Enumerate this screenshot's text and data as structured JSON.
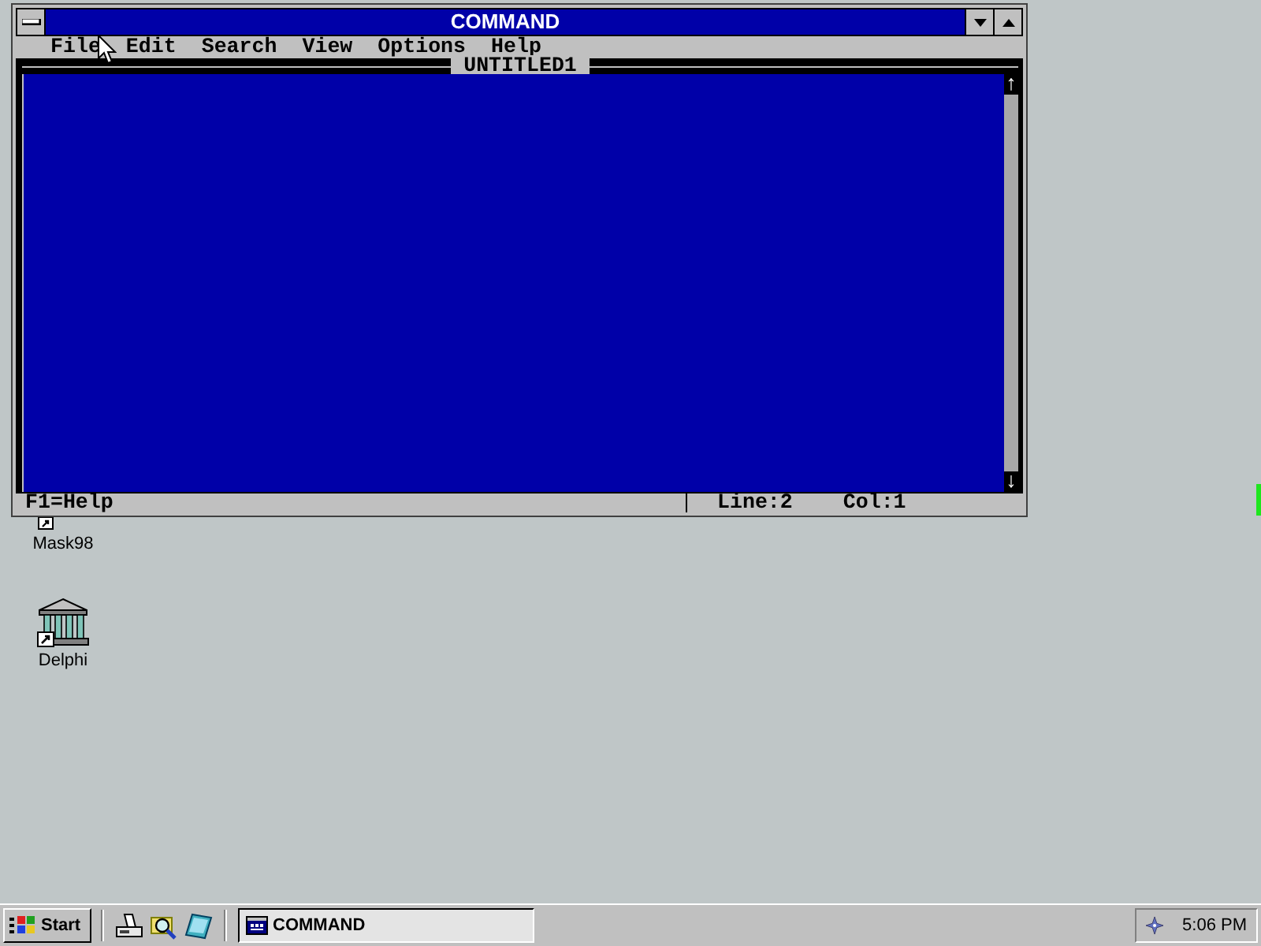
{
  "window": {
    "title": "COMMAND",
    "menu": [
      "File",
      "Edit",
      "Search",
      "View",
      "Options",
      "Help"
    ],
    "document_title": "UNTITLED1",
    "scrollbar": {
      "up": "↑",
      "down": "↓"
    },
    "status_bar": {
      "hint": "F1=Help",
      "line": "Line:2",
      "column": "Col:1"
    }
  },
  "desktop_icons": [
    {
      "label": "Mask98"
    },
    {
      "label": "Delphi"
    }
  ],
  "taskbar": {
    "start": "Start",
    "tasks": [
      {
        "label": "COMMAND",
        "selected": true
      }
    ],
    "clock": "5:06 PM"
  }
}
